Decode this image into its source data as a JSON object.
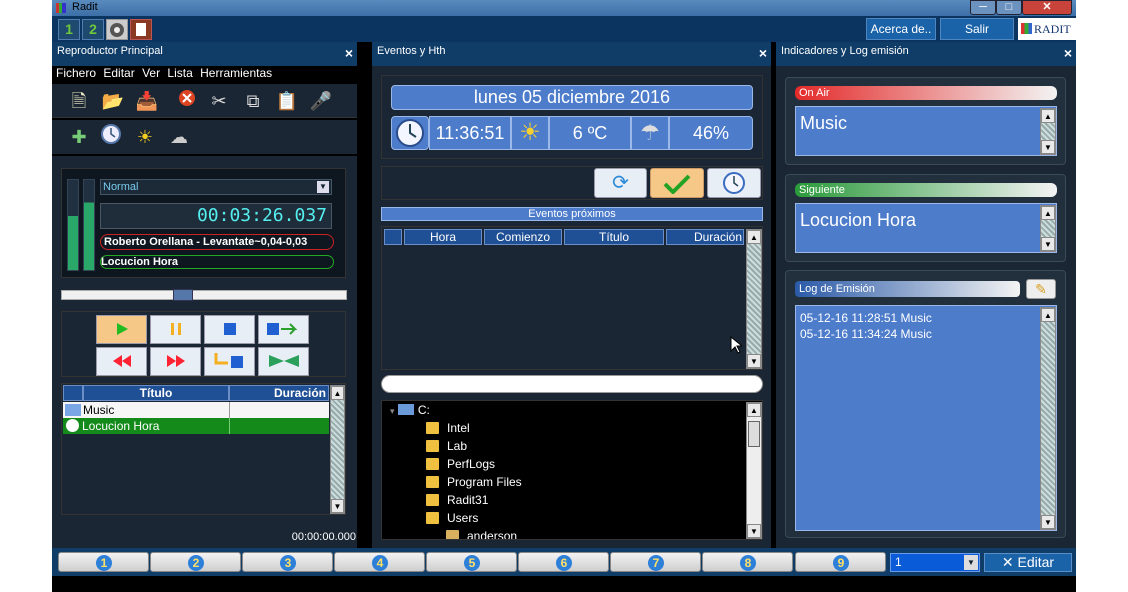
{
  "window": {
    "title": "Radit"
  },
  "toolbar": {
    "tab1": "1",
    "tab2": "2",
    "about_label": "Acerca de..",
    "exit_label": "Salir",
    "brand": "RADIT"
  },
  "left_panel": {
    "title": "Reproductor Principal",
    "menu": [
      "Fichero",
      "Editar",
      "Ver",
      "Lista",
      "Herramientas"
    ],
    "mode_select": "Normal",
    "time": "00:03:26.037",
    "now_playing": "Roberto Orellana - Levantate~0,04-0,03",
    "next_item": "Locucion Hora",
    "progress": 0.42,
    "playlist_headers": {
      "title": "Título",
      "duration": "Duración"
    },
    "playlist": [
      {
        "title": "Music",
        "duration": "",
        "icon": "music-icon",
        "selected": false
      },
      {
        "title": "Locucion Hora",
        "duration": "",
        "icon": "clock-icon",
        "selected": true
      }
    ],
    "total_time": "00:00:00.000"
  },
  "middle_panel": {
    "title": "Eventos y Hth",
    "date": "lunes  05 diciembre 2016",
    "clock": "11:36:51",
    "temperature": "6 ºC",
    "humidity": "46%",
    "events_title": "Eventos próximos",
    "events_headers": {
      "hora": "Hora",
      "comienzo": "Comienzo",
      "titulo": "Título",
      "duracion": "Duración"
    },
    "tree": [
      {
        "label": "C:",
        "level": 0,
        "icon": "drive-icon"
      },
      {
        "label": "Intel",
        "level": 1,
        "icon": "folder-icon"
      },
      {
        "label": "Lab",
        "level": 1,
        "icon": "folder-icon"
      },
      {
        "label": "PerfLogs",
        "level": 1,
        "icon": "folder-icon"
      },
      {
        "label": "Program Files",
        "level": 1,
        "icon": "folder-icon"
      },
      {
        "label": "Radit31",
        "level": 1,
        "icon": "folder-icon"
      },
      {
        "label": "Users",
        "level": 1,
        "icon": "folder-icon"
      },
      {
        "label": "anderson",
        "level": 2,
        "icon": "user-folder-icon"
      }
    ]
  },
  "right_panel": {
    "title": "Indicadores y Log emisión",
    "on_air_label": "On Air",
    "on_air_value": "Music",
    "next_label": "Siguiente",
    "next_value": "Locucion Hora",
    "log_label": "Log de Emisión",
    "log": [
      "05-12-16 11:28:51 Music",
      "05-12-16 11:34:24 Music"
    ]
  },
  "bottom_bar": {
    "buttons": [
      "1",
      "2",
      "3",
      "4",
      "5",
      "6",
      "7",
      "8",
      "9"
    ],
    "page_select": "1",
    "edit_label": "Editar"
  }
}
